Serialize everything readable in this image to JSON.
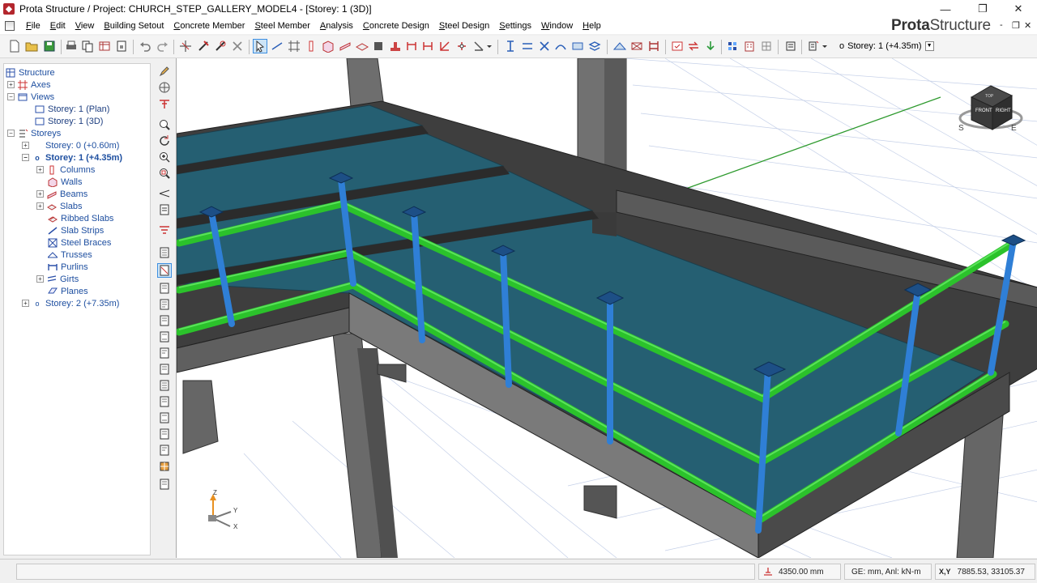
{
  "window": {
    "title": "Prota Structure / Project: CHURCH_STEP_GALLERY_MODEL4 - [Storey: 1 (3D)]",
    "minimize": "—",
    "restore": "❐",
    "close": "✕"
  },
  "menu": {
    "items": [
      "File",
      "Edit",
      "View",
      "Building Setout",
      "Concrete Member",
      "Steel Member",
      "Analysis",
      "Concrete Design",
      "Steel Design",
      "Settings",
      "Window",
      "Help"
    ],
    "brand_bold": "Prota",
    "brand_rest": "Structure",
    "mdi_min": "-",
    "mdi_restore": "❐",
    "mdi_close": "✕"
  },
  "toolbar": {
    "storey_selector": "Storey: 1 (+4.35m)",
    "storey_marker": "o"
  },
  "tree": {
    "nodes": [
      {
        "label": "Structure",
        "icon": "structure-icon"
      },
      {
        "label": "Axes",
        "icon": "axes-icon"
      },
      {
        "label": "Views",
        "icon": "folder-icon"
      },
      {
        "label": "Storey: 1 (Plan)",
        "icon": "view-icon"
      },
      {
        "label": "Storey: 1 (3D)",
        "icon": "view-icon"
      },
      {
        "label": "Storeys",
        "icon": "storeys-icon"
      },
      {
        "label": "Storey: 0 (+0.60m)",
        "icon": "storey-icon"
      },
      {
        "label": "Storey: 1 (+4.35m)",
        "icon": "storey-icon"
      },
      {
        "label": "Columns",
        "icon": "column-icon"
      },
      {
        "label": "Walls",
        "icon": "wall-icon"
      },
      {
        "label": "Beams",
        "icon": "beam-icon"
      },
      {
        "label": "Slabs",
        "icon": "slab-icon"
      },
      {
        "label": "Ribbed Slabs",
        "icon": "ribbed-slab-icon"
      },
      {
        "label": "Slab Strips",
        "icon": "slab-strip-icon"
      },
      {
        "label": "Steel Braces",
        "icon": "brace-icon"
      },
      {
        "label": "Trusses",
        "icon": "truss-icon"
      },
      {
        "label": "Purlins",
        "icon": "purlin-icon"
      },
      {
        "label": "Girts",
        "icon": "girt-icon"
      },
      {
        "label": "Planes",
        "icon": "plane-icon"
      },
      {
        "label": "Storey: 2 (+7.35m)",
        "icon": "storey-icon"
      }
    ]
  },
  "viewcube": {
    "front": "FRONT",
    "right": "RIGHT",
    "top": "TOP",
    "compass_s": "S",
    "compass_e": "E"
  },
  "axes_triad": {
    "z": "Z",
    "y": "Y",
    "x": "X"
  },
  "status": {
    "elevation": "4350.00 mm",
    "units": "GE: mm,  Anl: kN-m",
    "coords_label": "X,Y",
    "coords": "7885.53, 33105.37"
  },
  "colors": {
    "slab": "#255f72",
    "concrete": "#5a5a5a",
    "rail": "#2bc22b",
    "post": "#2f7fd6"
  }
}
